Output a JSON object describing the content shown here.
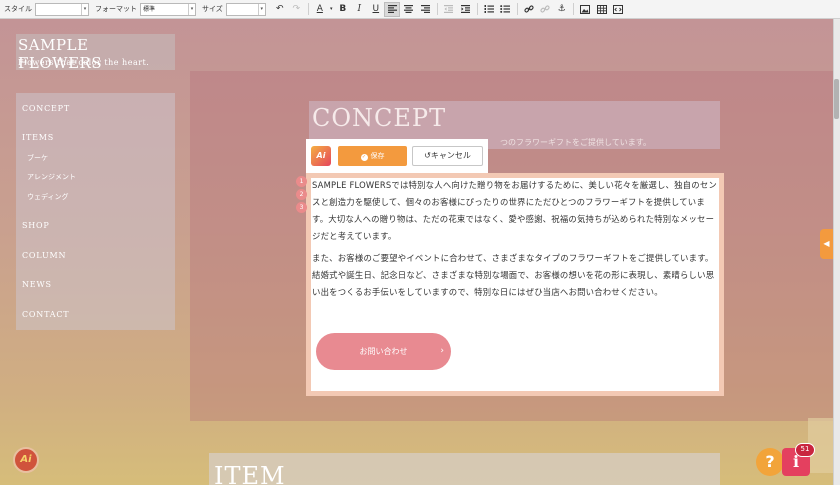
{
  "toolbar": {
    "style_label": "スタイル",
    "style_value": "",
    "format_label": "フォーマット",
    "format_value": "標準",
    "size_label": "サイズ",
    "size_value": ""
  },
  "site": {
    "logo_title": "SAMPLE FLOWERS",
    "logo_subtitle": "Flowers that color the heart."
  },
  "nav": {
    "items": [
      "CONCEPT",
      "ITEMS",
      "SHOP",
      "COLUMN",
      "NEWS",
      "CONTACT"
    ],
    "sub_items": [
      "ブーケ",
      "アレンジメント",
      "ウェディング"
    ]
  },
  "concept": {
    "title": "CONCEPT",
    "subtitle": "つのフラワーギフトをご提供しています。"
  },
  "editor": {
    "save_label": "保存",
    "cancel_label": "キャンセル",
    "line_numbers": [
      "1",
      "2",
      "3"
    ],
    "paragraph1": "SAMPLE FLOWERSでは特別な人へ向けた贈り物をお届けするために、美しい花々を厳選し、独自のセンスと創造力を駆使して、個々のお客様にぴったりの世界にただひとつのフラワーギフトを提供しています。大切な人への贈り物は、ただの花束ではなく、愛や感謝、祝福の気持ちが込められた特別なメッセージだと考えています。",
    "paragraph2": "また、お客様のご要望やイベントに合わせて、さまざまなタイプのフラワーギフトをご提供しています。結婚式や誕生日、記念日など、さまざまな特別な場面で、お客様の想いを花の形に表現し、素晴らしい思い出をつくるお手伝いをしていますので、特別な日にはぜひ当店へお問い合わせください。",
    "contact_button": "お問い合わせ"
  },
  "item_section": {
    "title": "ITEM"
  },
  "floating": {
    "help_label": "?",
    "info_label": "i",
    "notification_count": "51"
  },
  "colors": {
    "accent_orange": "#f39a3e",
    "accent_pink": "#e88a91",
    "badge_red": "#c9253f"
  }
}
